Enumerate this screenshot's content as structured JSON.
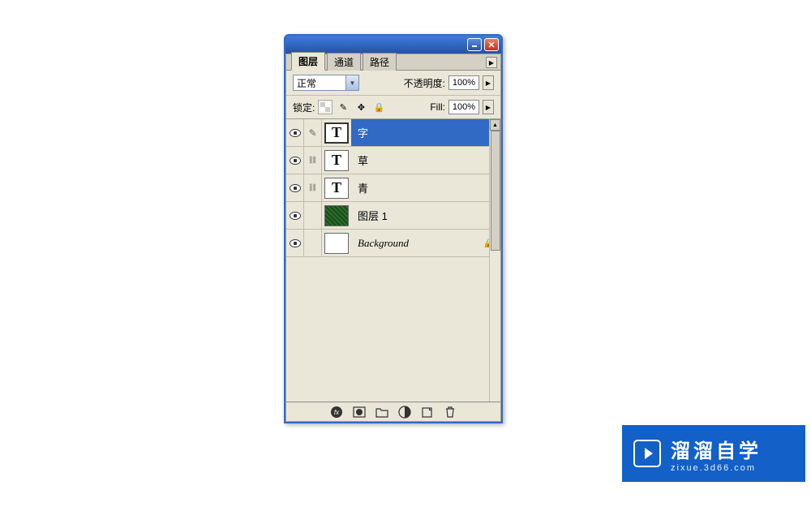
{
  "panel": {
    "tabs": [
      {
        "label": "图层",
        "active": true
      },
      {
        "label": "通道",
        "active": false
      },
      {
        "label": "路径",
        "active": false
      }
    ],
    "blend_mode": "正常",
    "opacity_label": "不透明度:",
    "opacity_value": "100%",
    "lock_label": "锁定:",
    "fill_label": "Fill:",
    "fill_value": "100%",
    "layers": [
      {
        "name": "字",
        "thumb_type": "T",
        "selected": true,
        "vis": true,
        "link_icon": "brush",
        "locked": false,
        "italic": false
      },
      {
        "name": "草",
        "thumb_type": "T",
        "selected": false,
        "vis": true,
        "link_icon": "link",
        "locked": false,
        "italic": false
      },
      {
        "name": "青",
        "thumb_type": "T",
        "selected": false,
        "vis": true,
        "link_icon": "link",
        "locked": false,
        "italic": false
      },
      {
        "name": "图层 1",
        "thumb_type": "grass",
        "selected": false,
        "vis": true,
        "link_icon": "",
        "locked": false,
        "italic": false
      },
      {
        "name": "Background",
        "thumb_type": "white",
        "selected": false,
        "vis": true,
        "link_icon": "",
        "locked": true,
        "italic": true
      }
    ],
    "bottom_icons": [
      "fx",
      "mask",
      "folder",
      "adjustment",
      "new",
      "trash"
    ]
  },
  "brand": {
    "title": "溜溜自学",
    "url": "zixue.3d66.com"
  }
}
